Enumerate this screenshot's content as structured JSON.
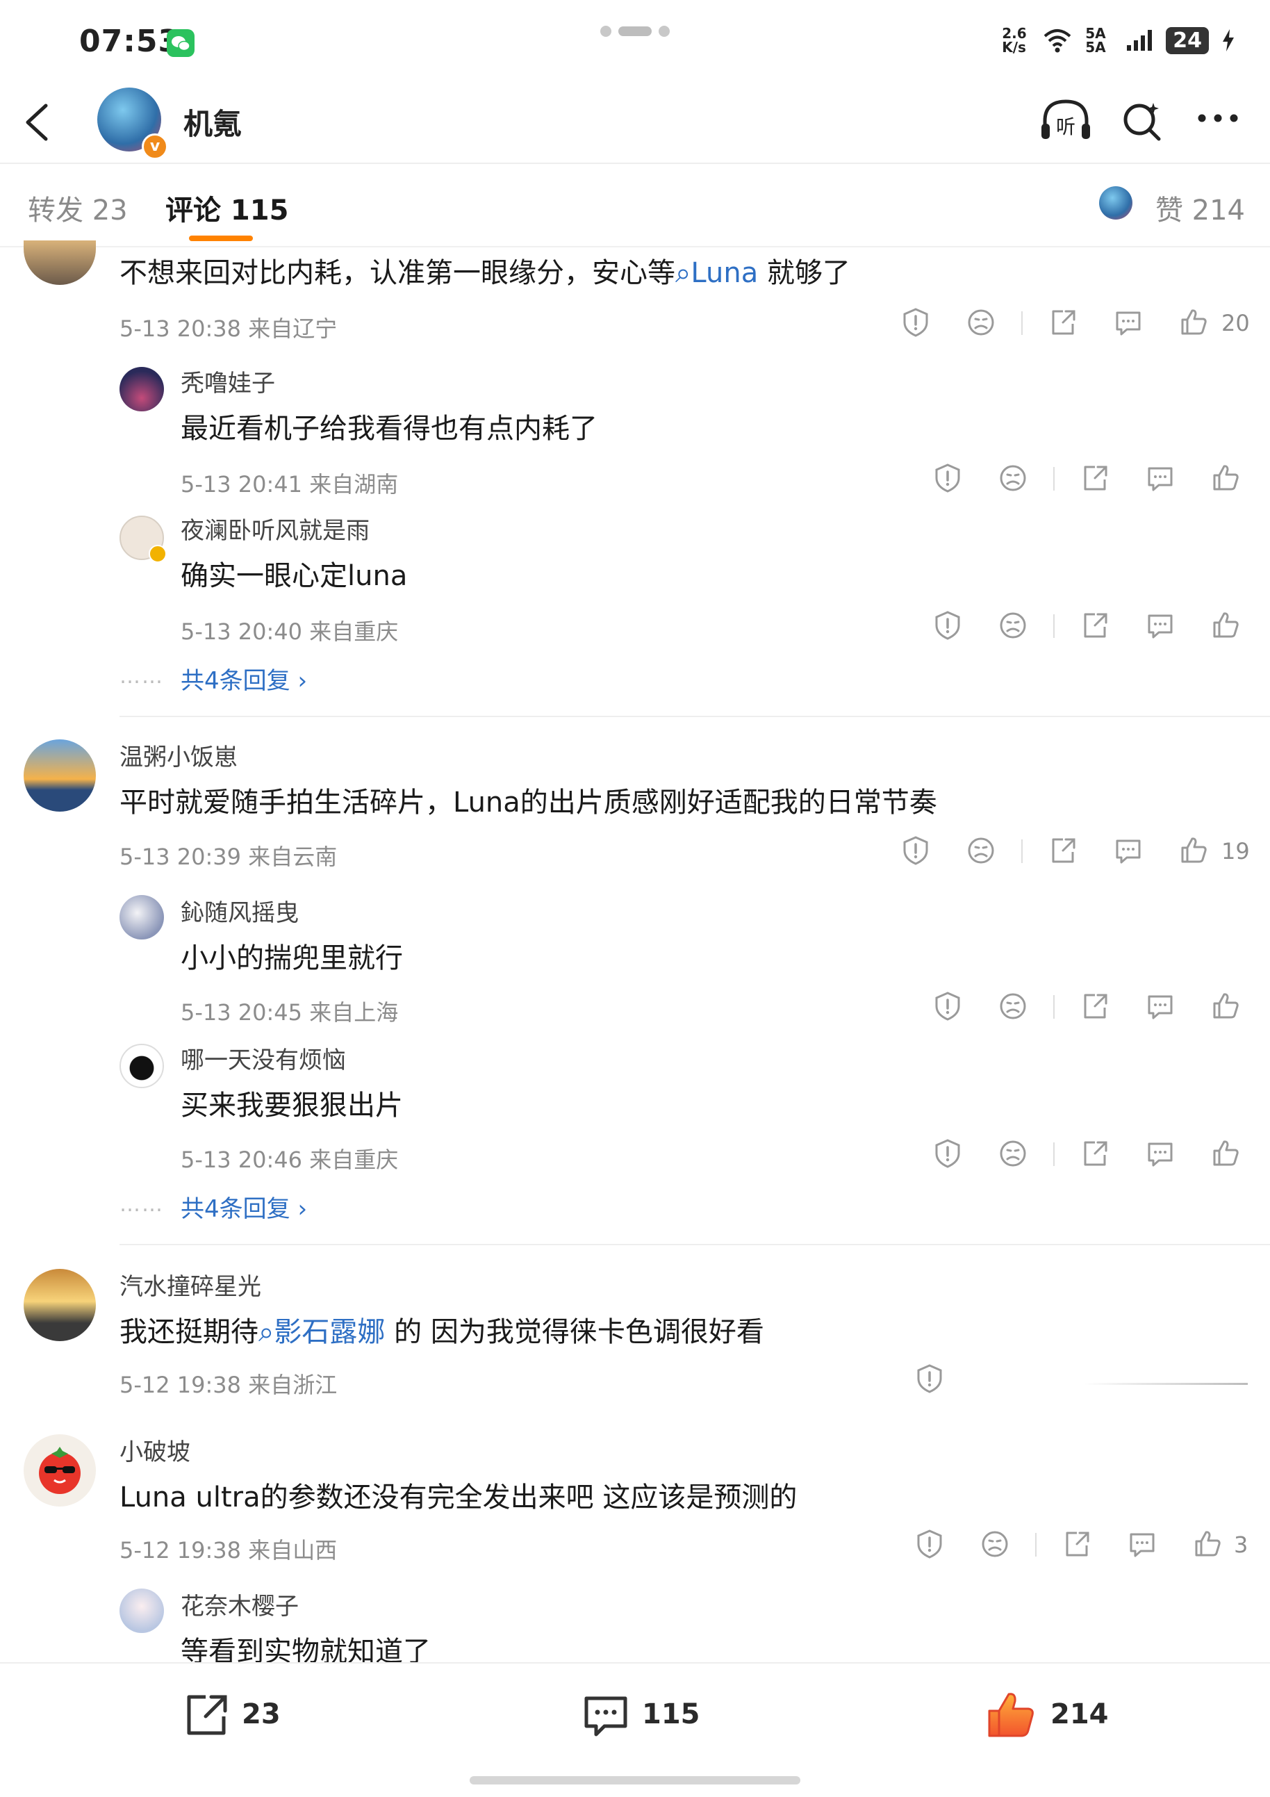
{
  "status": {
    "time": "07:53",
    "speed": "2.6 K/s",
    "signal": "5A 5A",
    "battery": "24"
  },
  "header": {
    "title": "机氪"
  },
  "tabs": {
    "repost": "转发 23",
    "comments": "评论 115",
    "likes": "赞 214"
  },
  "thread1": {
    "text_before": "不想来回对比内耗，认准第一眼缘分，安心等",
    "link": "Luna",
    "text_after": "就够了",
    "meta": "5-13 20:38 来自辽宁",
    "likes": "20",
    "replies": [
      {
        "name": "秃噜娃子",
        "text": "最近看机子给我看得也有点内耗了",
        "meta": "5-13 20:41 来自湖南"
      },
      {
        "name": "夜澜卧听风就是雨",
        "text": "确实一眼心定luna",
        "meta": "5-13 20:40 来自重庆"
      }
    ],
    "more_dots": "……",
    "more": "共4条回复 ›"
  },
  "thread2": {
    "name": "温粥小饭崽",
    "text": "平时就爱随手拍生活碎片，Luna的出片质感刚好适配我的日常节奏",
    "meta": "5-13 20:39 来自云南",
    "likes": "19",
    "replies": [
      {
        "name": "鈊随风摇曳",
        "text": "小小的揣兜里就行",
        "meta": "5-13 20:45 来自上海"
      },
      {
        "name": "哪一天没有烦恼",
        "text": "买来我要狠狠出片",
        "meta": "5-13 20:46 来自重庆"
      }
    ],
    "more_dots": "……",
    "more": "共4条回复 ›"
  },
  "thread3": {
    "name": "汽水撞碎星光",
    "text_before": "我还挺期待",
    "link": "影石露娜",
    "text_after": "的 因为我觉得徕卡色调很好看",
    "meta": "5-12 19:38 来自浙江"
  },
  "thread4": {
    "name": "小破坡",
    "text": "Luna ultra的参数还没有完全发出来吧 这应该是预测的",
    "meta": "5-12 19:38 来自山西",
    "likes": "3",
    "replies": [
      {
        "name": "花奈木樱子",
        "text": "等看到实物就知道了"
      }
    ]
  },
  "bottom": {
    "reposts": "23",
    "comments": "115",
    "likes": "214"
  },
  "colors": {
    "accent": "#ff8200",
    "link": "#2e6fc4",
    "meta": "#8c8c8c"
  },
  "icons": [
    "back-icon",
    "headphones-listen-icon",
    "search-icon",
    "more-icon",
    "report-icon",
    "dislike-face-icon",
    "share-icon",
    "reply-icon",
    "like-icon",
    "chevron-right-icon"
  ]
}
